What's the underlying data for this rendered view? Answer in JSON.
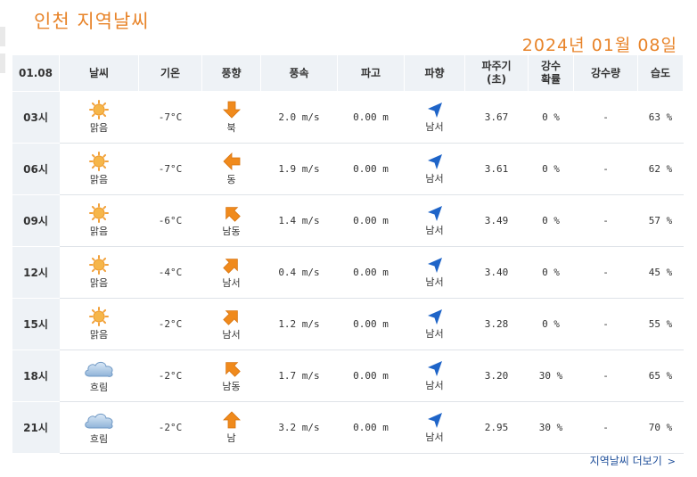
{
  "header": {
    "title": "인천 지역날씨",
    "date": "2024년 01월 08일"
  },
  "columns": [
    "01.08",
    "날씨",
    "기온",
    "풍향",
    "풍속",
    "파고",
    "파향",
    "파주기\n(초)",
    "강수\n확률",
    "강수량",
    "습도"
  ],
  "rows": [
    {
      "time": "03시",
      "weather": "맑음",
      "weather_icon": "sun-icon",
      "temp": "-7°C",
      "wind_dir": "북",
      "wind_icon": "arrow-down-icon",
      "wind_speed": "2.0 m/s",
      "wave_height": "0.00 m",
      "wave_dir": "남서",
      "wave_period": "3.67",
      "precip_prob": "0 %",
      "precip_amt": "-",
      "humidity": "63 %"
    },
    {
      "time": "06시",
      "weather": "맑음",
      "weather_icon": "sun-icon",
      "temp": "-7°C",
      "wind_dir": "동",
      "wind_icon": "arrow-left-icon",
      "wind_speed": "1.9 m/s",
      "wave_height": "0.00 m",
      "wave_dir": "남서",
      "wave_period": "3.61",
      "precip_prob": "0 %",
      "precip_amt": "-",
      "humidity": "62 %"
    },
    {
      "time": "09시",
      "weather": "맑음",
      "weather_icon": "sun-icon",
      "temp": "-6°C",
      "wind_dir": "남동",
      "wind_icon": "arrow-up-left-icon",
      "wind_speed": "1.4 m/s",
      "wave_height": "0.00 m",
      "wave_dir": "남서",
      "wave_period": "3.49",
      "precip_prob": "0 %",
      "precip_amt": "-",
      "humidity": "57 %"
    },
    {
      "time": "12시",
      "weather": "맑음",
      "weather_icon": "sun-icon",
      "temp": "-4°C",
      "wind_dir": "남서",
      "wind_icon": "arrow-up-right-icon",
      "wind_speed": "0.4 m/s",
      "wave_height": "0.00 m",
      "wave_dir": "남서",
      "wave_period": "3.40",
      "precip_prob": "0 %",
      "precip_amt": "-",
      "humidity": "45 %"
    },
    {
      "time": "15시",
      "weather": "맑음",
      "weather_icon": "sun-icon",
      "temp": "-2°C",
      "wind_dir": "남서",
      "wind_icon": "arrow-up-right-icon",
      "wind_speed": "1.2 m/s",
      "wave_height": "0.00 m",
      "wave_dir": "남서",
      "wave_period": "3.28",
      "precip_prob": "0 %",
      "precip_amt": "-",
      "humidity": "55 %"
    },
    {
      "time": "18시",
      "weather": "흐림",
      "weather_icon": "cloud-icon",
      "temp": "-2°C",
      "wind_dir": "남동",
      "wind_icon": "arrow-up-left-icon",
      "wind_speed": "1.7 m/s",
      "wave_height": "0.00 m",
      "wave_dir": "남서",
      "wave_period": "3.20",
      "precip_prob": "30 %",
      "precip_amt": "-",
      "humidity": "65 %"
    },
    {
      "time": "21시",
      "weather": "흐림",
      "weather_icon": "cloud-icon",
      "temp": "-2°C",
      "wind_dir": "남",
      "wind_icon": "arrow-up-icon",
      "wind_speed": "3.2 m/s",
      "wave_height": "0.00 m",
      "wave_dir": "남서",
      "wave_period": "2.95",
      "precip_prob": "30 %",
      "precip_amt": "-",
      "humidity": "70 %"
    }
  ],
  "more_link": "지역날씨 더보기",
  "colors": {
    "accent": "#e8842a",
    "header_bg": "#eef2f6",
    "wind_arrow": "#f08a1c",
    "wave_arrow": "#1e64c8",
    "link": "#1f4f9a"
  }
}
